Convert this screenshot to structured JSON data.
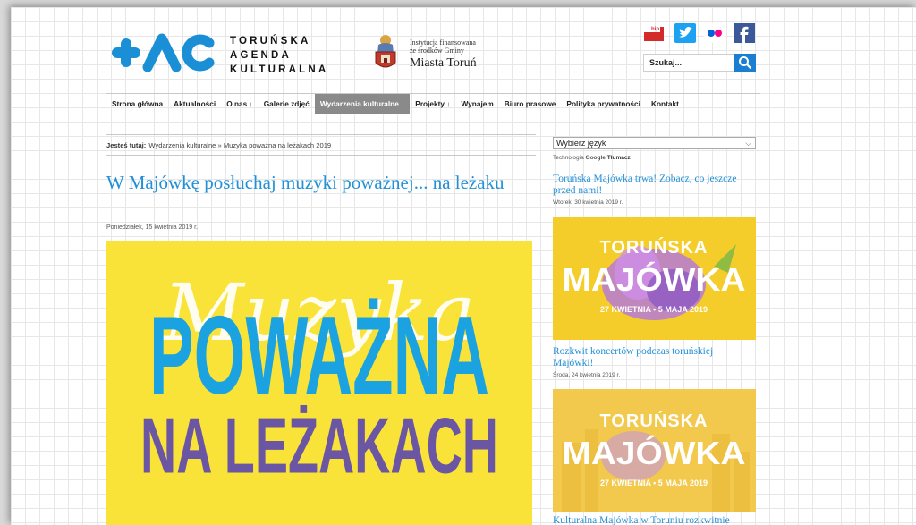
{
  "header": {
    "logo_lines": [
      "TORUŃSKA",
      "AGENDA",
      "KULTURALNA"
    ],
    "institution_small_lines": [
      "Instytucja finansowana",
      "ze środków Gminy"
    ],
    "institution_big": "Miasta Toruń",
    "search_placeholder": "Szukaj...",
    "social_icons": [
      "bip-icon",
      "twitter-icon",
      "flickr-icon",
      "facebook-icon"
    ]
  },
  "nav": {
    "items": [
      "Strona główna",
      "Aktualności",
      "O nas ↓",
      "Galerie zdjęć",
      "Wydarzenia kulturalne ↓",
      "Projekty ↓",
      "Wynajem",
      "Biuro prasowe",
      "Polityka prywatności",
      "Kontakt"
    ]
  },
  "breadcrumb": {
    "label": "Jesteś tutaj:",
    "path": "Wydarzenia kulturalne » Muzyka poważna na leżakach 2019"
  },
  "article": {
    "title": "W Majówkę posłuchaj muzyki poważnej... na leżaku",
    "date": "Poniedziałek, 15 kwietnia 2019 r.",
    "hero": {
      "script_text": "Muzyka",
      "line1": "POWAŻNA",
      "line2": "NA LEŻAKACH"
    }
  },
  "sidebar": {
    "language_select": "Wybierz język",
    "translate_prefix": "Technologia",
    "translate_google": "Google",
    "translate_label": "Tłumacz",
    "posts": [
      {
        "title": "Toruńska Majówka trwa! Zobacz, co jeszcze przed nami!",
        "date": "Wtorek, 30 kwietnia 2019 r."
      },
      {
        "title": "Rozkwit koncertów podczas toruńskiej Majówki!",
        "date": "Środa, 24 kwietnia 2019 r."
      },
      {
        "title": "Kulturalna Majówka w Toruniu rozkwitnie",
        "date": ""
      }
    ],
    "banner": {
      "line1": "TORUŃSKA",
      "line2": "MAJÓWKA",
      "dates": "27 KWIETNIA • 5 MAJA 2019"
    }
  },
  "colors": {
    "link_blue": "#2290d6",
    "logo_blue": "#1a8fd6",
    "nav_active": "#8a8a8a",
    "hero_yellow": "#f9e339",
    "hero_blue": "#1aa3e0",
    "hero_purple": "#6b56a4",
    "banner_yellow": "#f5cd2a"
  }
}
